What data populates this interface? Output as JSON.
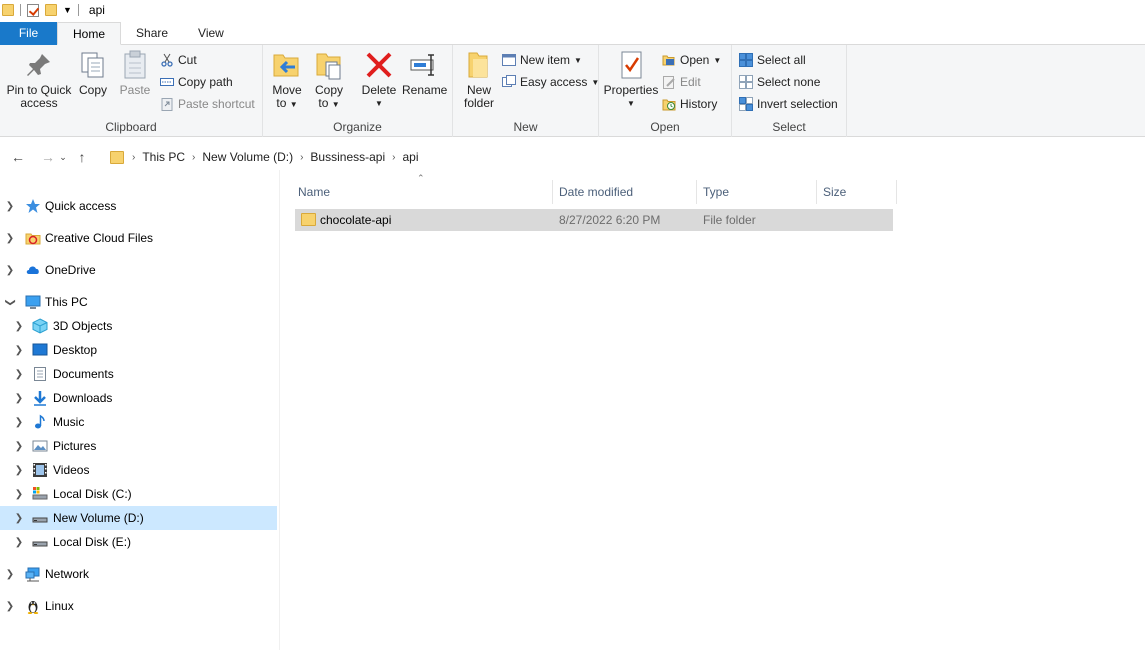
{
  "window": {
    "title": "api"
  },
  "tabs": [
    {
      "label": "File"
    },
    {
      "label": "Home"
    },
    {
      "label": "Share"
    },
    {
      "label": "View"
    }
  ],
  "ribbon": {
    "clipboard": {
      "label": "Clipboard",
      "pin": "Pin to Quick access",
      "pin_line1": "Pin to Quick",
      "pin_line2": "access",
      "copy": "Copy",
      "paste": "Paste",
      "cut": "Cut",
      "copy_path": "Copy path",
      "paste_shortcut": "Paste shortcut"
    },
    "organize": {
      "label": "Organize",
      "move_line1": "Move",
      "move_line2": "to",
      "copy_line1": "Copy",
      "copy_line2": "to",
      "delete": "Delete",
      "rename": "Rename"
    },
    "new": {
      "label": "New",
      "new_folder_line1": "New",
      "new_folder_line2": "folder",
      "new_item": "New item",
      "easy_access": "Easy access"
    },
    "open": {
      "label": "Open",
      "properties": "Properties",
      "open": "Open",
      "edit": "Edit",
      "history": "History"
    },
    "select": {
      "label": "Select",
      "select_all": "Select all",
      "select_none": "Select none",
      "invert": "Invert selection"
    }
  },
  "address": {
    "crumbs": [
      "This PC",
      "New Volume (D:)",
      "Bussiness-api",
      "api"
    ]
  },
  "tree": [
    {
      "label": "Quick access",
      "icon": "star-icon"
    },
    {
      "label": "Creative Cloud Files",
      "icon": "creative-cloud-icon"
    },
    {
      "label": "OneDrive",
      "icon": "cloud-icon"
    },
    {
      "label": "This PC",
      "icon": "computer-icon"
    },
    {
      "label": "3D Objects",
      "icon": "cube-icon"
    },
    {
      "label": "Desktop",
      "icon": "desktop-icon"
    },
    {
      "label": "Documents",
      "icon": "document-icon"
    },
    {
      "label": "Downloads",
      "icon": "download-icon"
    },
    {
      "label": "Music",
      "icon": "music-icon"
    },
    {
      "label": "Pictures",
      "icon": "picture-icon"
    },
    {
      "label": "Videos",
      "icon": "video-icon"
    },
    {
      "label": "Local Disk (C:)",
      "icon": "disk-icon"
    },
    {
      "label": "New Volume (D:)",
      "icon": "disk-icon"
    },
    {
      "label": "Local Disk (E:)",
      "icon": "disk-icon"
    },
    {
      "label": "Network",
      "icon": "network-icon"
    },
    {
      "label": "Linux",
      "icon": "linux-icon"
    }
  ],
  "columns": {
    "name": "Name",
    "date": "Date modified",
    "type": "Type",
    "size": "Size"
  },
  "files": [
    {
      "name": "chocolate-api",
      "date": "8/27/2022 6:20 PM",
      "type": "File folder",
      "size": ""
    }
  ],
  "colors": {
    "accent": "#1979ca",
    "selection": "#cce8ff",
    "row_highlight": "#d9d9d9",
    "folder": "#f7d26e"
  }
}
